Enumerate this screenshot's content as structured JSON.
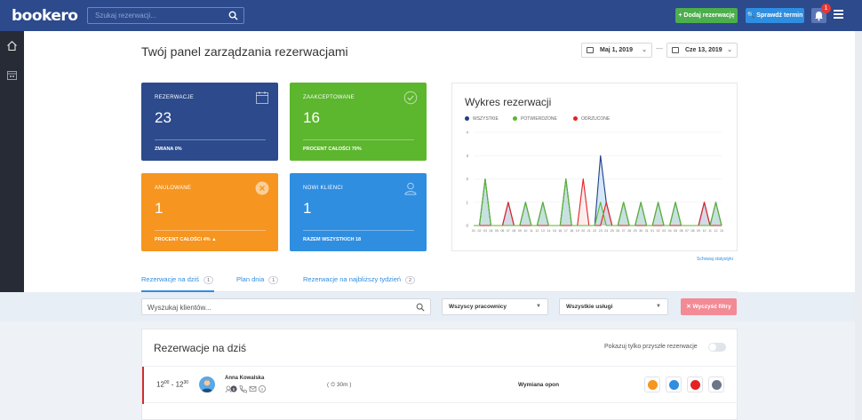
{
  "app": {
    "logo": "bookero"
  },
  "topbar": {
    "search_placeholder": "Szukaj rezerwacji...",
    "add_booking": "+ Dodaj rezerwację",
    "check_date": "🔍 Sprawdź termin",
    "notifications_count": "1"
  },
  "header": {
    "title": "Twój panel zarządzania rezerwacjami",
    "date_from": "Maj 1, 2019",
    "date_sep": "—",
    "date_to": "Cze 13, 2019"
  },
  "cards": [
    {
      "label": "REZERWACJE",
      "value": "23",
      "footer": "ZMIANA  0%",
      "color": "#2c4a8c",
      "icon": "calendar-icon"
    },
    {
      "label": "ZAAKCEPTOWANE",
      "value": "16",
      "footer": "PROCENT CAŁOŚCI  70%",
      "color": "#5cb62e",
      "icon": "check-circle-icon"
    },
    {
      "label": "ANULOWANE",
      "value": "1",
      "footer": "PROCENT CAŁOŚCI  4%  ▲",
      "color": "#f6951f",
      "icon": "cancel-circle-icon"
    },
    {
      "label": "NOWI KLIENCI",
      "value": "1",
      "footer": "RAZEM WSZYSTKICH  18",
      "color": "#2f8ee0",
      "icon": "user-icon"
    }
  ],
  "chart": {
    "title": "Wykres rezerwacji",
    "show_stats": "Schowaj statystyki"
  },
  "chart_data": {
    "type": "area",
    "x": [
      "01",
      "02",
      "03",
      "04",
      "05",
      "06",
      "07",
      "08",
      "09",
      "10",
      "11",
      "12",
      "13",
      "14",
      "15",
      "16",
      "17",
      "18",
      "19",
      "20",
      "21",
      "22",
      "23",
      "24",
      "25",
      "26",
      "27",
      "28",
      "29",
      "30",
      "31",
      "01",
      "02",
      "03",
      "04",
      "05",
      "06",
      "07",
      "08",
      "09",
      "10",
      "11",
      "12",
      "13"
    ],
    "series": [
      {
        "name": "WSZYSTKIE",
        "color": "#1f3f8a",
        "values": [
          0,
          0,
          2,
          0,
          0,
          0,
          1,
          0,
          0,
          1,
          0,
          0,
          1,
          0,
          0,
          0,
          2,
          0,
          0,
          0,
          0,
          0,
          3,
          1,
          0,
          0,
          1,
          0,
          0,
          1,
          0,
          0,
          1,
          0,
          0,
          1,
          0,
          0,
          0,
          0,
          1,
          0,
          1,
          0
        ]
      },
      {
        "name": "POTWIERDZONE",
        "color": "#5cb62e",
        "values": [
          0,
          0,
          2,
          0,
          0,
          0,
          0,
          0,
          0,
          1,
          0,
          0,
          1,
          0,
          0,
          0,
          2,
          0,
          0,
          0,
          0,
          0,
          1,
          0,
          0,
          0,
          1,
          0,
          0,
          1,
          0,
          0,
          1,
          0,
          0,
          1,
          0,
          0,
          0,
          0,
          0,
          0,
          1,
          0
        ]
      },
      {
        "name": "ODRZUCONE",
        "color": "#e52222",
        "values": [
          0,
          0,
          0,
          0,
          0,
          0,
          1,
          0,
          0,
          0,
          0,
          0,
          0,
          0,
          0,
          0,
          0,
          0,
          0,
          2,
          0,
          0,
          0,
          1,
          0,
          0,
          0,
          0,
          0,
          0,
          0,
          0,
          0,
          0,
          0,
          0,
          0,
          0,
          0,
          0,
          1,
          0,
          0,
          0
        ]
      }
    ],
    "ylim": [
      0,
      4
    ],
    "yticks": [
      "0",
      "1",
      "2",
      "3",
      "4"
    ]
  },
  "tabs": [
    {
      "label": "Rezerwacje na dziś",
      "count": "1"
    },
    {
      "label": "Plan dnia",
      "count": "1"
    },
    {
      "label": "Rezerwacje na najbliższy tydzień",
      "count": "2"
    }
  ],
  "filters": {
    "search_placeholder": "Wyszukaj klientów...",
    "workers": "Wszyscy pracownicy",
    "services": "Wszystkie usługi",
    "clear": "✕  Wyczyść filtry"
  },
  "bookings_panel": {
    "title": "Rezerwacje na dziś",
    "future_toggle": "Pokazuj tylko przyszłe rezerwacje",
    "rows": [
      {
        "time_start": "12",
        "time_start_min": "00",
        "time_end": "12",
        "time_end_min": "30",
        "client": "Anna Kowalska",
        "duration": "( ⏲ 30m )",
        "service": "Wymiana opon"
      }
    ]
  }
}
